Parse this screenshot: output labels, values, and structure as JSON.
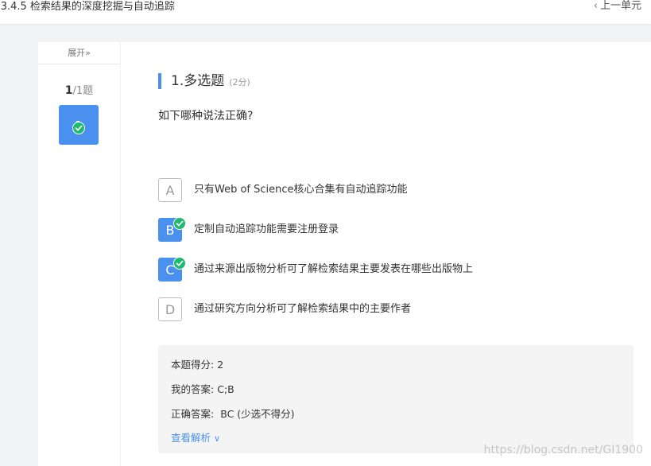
{
  "header": {
    "course_title": "-3.4.5 检索结果的深度挖掘与自动追踪",
    "prev_unit_label": "上一单元"
  },
  "sidebar": {
    "expand_label": "展开»",
    "counter_current": "1",
    "counter_total": "/1题",
    "question_number": "1"
  },
  "question": {
    "title": "1.多选题",
    "points": "(2分)",
    "text": "如下哪种说法正确?",
    "options": [
      {
        "letter": "A",
        "text": "只有Web of Science核心合集有自动追踪功能",
        "selected": false
      },
      {
        "letter": "B",
        "text": "定制自动追踪功能需要注册登录",
        "selected": true
      },
      {
        "letter": "C",
        "text": "通过来源出版物分析可了解检索结果主要发表在哪些出版物上",
        "selected": true
      },
      {
        "letter": "D",
        "text": "通过研究方向分析可了解检索结果中的主要作者",
        "selected": false
      }
    ]
  },
  "result": {
    "score_label": "本题得分:",
    "score_value": "2",
    "my_answer_label": "我的答案:",
    "my_answer_value": "C;B",
    "correct_label": "正确答案:",
    "correct_value": "BC (少选不得分)",
    "analysis_label": "查看解析"
  },
  "watermark": "https://blog.csdn.net/GI1900",
  "colors": {
    "accent": "#4a90ee",
    "check_green": "#1fbb6c"
  }
}
